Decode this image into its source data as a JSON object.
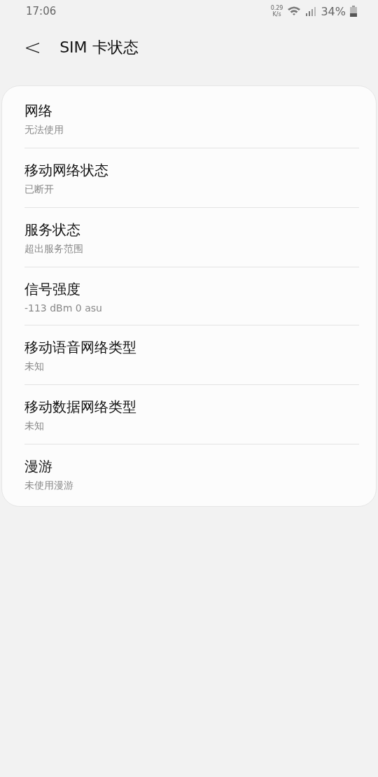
{
  "status_bar": {
    "time": "17:06",
    "speed": "0.29",
    "speed_unit": "K/s",
    "battery": "34%"
  },
  "header": {
    "back": "<",
    "title": "SIM 卡状态"
  },
  "items": [
    {
      "title": "网络",
      "value": "无法使用"
    },
    {
      "title": "移动网络状态",
      "value": "已断开"
    },
    {
      "title": "服务状态",
      "value": "超出服务范围"
    },
    {
      "title": "信号强度",
      "value": "-113 dBm 0 asu"
    },
    {
      "title": "移动语音网络类型",
      "value": "未知"
    },
    {
      "title": "移动数据网络类型",
      "value": "未知"
    },
    {
      "title": "漫游",
      "value": "未使用漫游"
    }
  ]
}
